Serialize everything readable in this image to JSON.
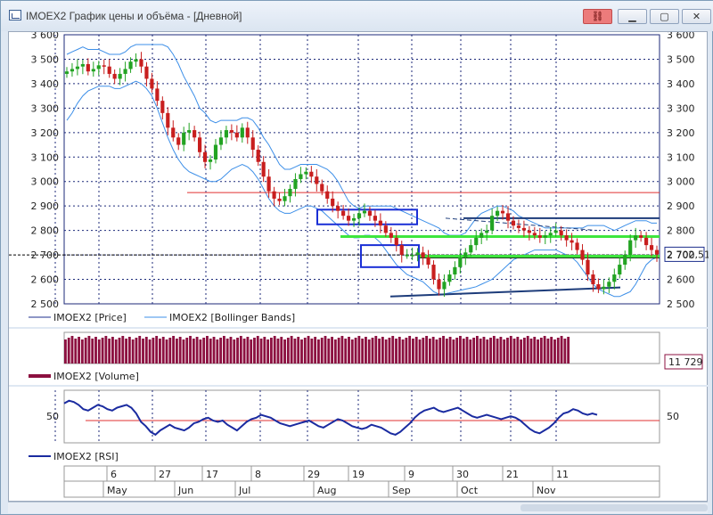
{
  "window": {
    "title": "IMOEX2 График цены и объёма - [Дневной]",
    "buttons": [
      "link",
      "minimize",
      "maximize",
      "close"
    ]
  },
  "colors": {
    "candle_up": "#22a322",
    "candle_down": "#c81e1e",
    "bollinger": "#3d8fe8",
    "price_line": "#1d2f8c",
    "volume": "#8c1040",
    "rsi": "#1a2ba0",
    "level_red": "#e03030",
    "level_green": "#3ee63e",
    "level_navy": "#1d3c7a",
    "box_blue": "#1a2fd6",
    "grid": "#1c2a7a"
  },
  "chart_data": [
    {
      "type": "candlestick",
      "panel": "price",
      "ylim": [
        2500,
        3600
      ],
      "yticks": [
        2500,
        2600,
        2700,
        2800,
        2900,
        3000,
        3100,
        3200,
        3300,
        3400,
        3500,
        3600
      ],
      "ytick_labels": [
        "2 500",
        "2 600",
        "2 700",
        "2 800",
        "2 900",
        "3 000",
        "3 100",
        "3 200",
        "3 300",
        "3 400",
        "3 500",
        "3 600"
      ],
      "last_value_label": "2 702,51",
      "series": [
        {
          "name": "IMOEX2 [Price]",
          "close": [
            3450,
            3460,
            3470,
            3480,
            3450,
            3460,
            3475,
            3470,
            3440,
            3420,
            3440,
            3460,
            3490,
            3500,
            3470,
            3420,
            3380,
            3330,
            3280,
            3220,
            3180,
            3150,
            3200,
            3210,
            3180,
            3120,
            3080,
            3090,
            3150,
            3180,
            3210,
            3200,
            3180,
            3220,
            3180,
            3130,
            3080,
            3020,
            2960,
            2930,
            2920,
            2940,
            2970,
            3010,
            3030,
            3040,
            3020,
            2990,
            2960,
            2930,
            2900,
            2880,
            2860,
            2840,
            2850,
            2870,
            2880,
            2860,
            2840,
            2820,
            2790,
            2770,
            2740,
            2700,
            2700,
            2700,
            2710,
            2690,
            2660,
            2600,
            2560,
            2590,
            2620,
            2650,
            2690,
            2710,
            2740,
            2770,
            2790,
            2800,
            2860,
            2880,
            2870,
            2840,
            2820,
            2810,
            2800,
            2790,
            2780,
            2770,
            2780,
            2790,
            2800,
            2780,
            2760,
            2750,
            2720,
            2680,
            2620,
            2580,
            2560,
            2570,
            2590,
            2620,
            2660,
            2700,
            2760,
            2780,
            2770,
            2740,
            2720,
            2702.51
          ]
        },
        {
          "name": "IMOEX2 [Bollinger Bands]",
          "upper": [
            3520,
            3530,
            3540,
            3550,
            3540,
            3540,
            3540,
            3530,
            3520,
            3520,
            3520,
            3530,
            3550,
            3560,
            3560,
            3560,
            3560,
            3560,
            3560,
            3550,
            3520,
            3480,
            3430,
            3390,
            3350,
            3300,
            3280,
            3250,
            3240,
            3250,
            3250,
            3250,
            3250,
            3260,
            3260,
            3250,
            3220,
            3180,
            3150,
            3110,
            3070,
            3050,
            3050,
            3060,
            3070,
            3070,
            3070,
            3070,
            3060,
            3050,
            3030,
            3000,
            2960,
            2920,
            2900,
            2890,
            2900,
            2900,
            2900,
            2900,
            2900,
            2900,
            2890,
            2880,
            2870,
            2860,
            2850,
            2840,
            2830,
            2820,
            2810,
            2790,
            2780,
            2780,
            2780,
            2790,
            2820,
            2850,
            2870,
            2880,
            2890,
            2900,
            2900,
            2890,
            2880,
            2860,
            2850,
            2840,
            2830,
            2820,
            2810,
            2810,
            2810,
            2810,
            2810,
            2810,
            2810,
            2810,
            2820,
            2820,
            2820,
            2820,
            2810,
            2800,
            2810,
            2820,
            2830,
            2840,
            2840,
            2840,
            2830,
            2830
          ],
          "lower": [
            3250,
            3280,
            3320,
            3350,
            3370,
            3380,
            3390,
            3390,
            3390,
            3380,
            3380,
            3390,
            3400,
            3410,
            3400,
            3380,
            3350,
            3300,
            3240,
            3180,
            3130,
            3090,
            3060,
            3040,
            3030,
            3020,
            3010,
            3000,
            3000,
            3010,
            3030,
            3050,
            3060,
            3070,
            3060,
            3040,
            3010,
            2970,
            2930,
            2900,
            2880,
            2870,
            2870,
            2880,
            2890,
            2900,
            2900,
            2890,
            2880,
            2860,
            2840,
            2820,
            2800,
            2780,
            2770,
            2770,
            2780,
            2780,
            2770,
            2750,
            2720,
            2690,
            2660,
            2640,
            2620,
            2610,
            2600,
            2590,
            2570,
            2550,
            2540,
            2540,
            2545,
            2550,
            2555,
            2560,
            2565,
            2570,
            2580,
            2590,
            2600,
            2620,
            2640,
            2660,
            2680,
            2690,
            2700,
            2710,
            2720,
            2720,
            2720,
            2720,
            2720,
            2710,
            2700,
            2690,
            2670,
            2640,
            2610,
            2580,
            2560,
            2550,
            2540,
            2530,
            2530,
            2540,
            2550,
            2580,
            2620,
            2660,
            2680,
            2690
          ]
        }
      ],
      "levels": [
        {
          "value": 2955,
          "color": "red"
        },
        {
          "value": 2775,
          "color": "green"
        },
        {
          "value": 2695,
          "color": "green"
        },
        {
          "value": 2850,
          "color": "navy"
        },
        {
          "value": 2700,
          "color": "black-dotted"
        }
      ]
    },
    {
      "type": "bar",
      "panel": "volume",
      "series": [
        {
          "name": "IMOEX2 [Volume]"
        }
      ],
      "last_value_label": "11 729"
    },
    {
      "type": "line",
      "panel": "rsi",
      "yticks": [
        50
      ],
      "ytick_labels": [
        "50"
      ],
      "reference_level": 44,
      "series": [
        {
          "name": "IMOEX2 [RSI]",
          "values": [
            68,
            72,
            70,
            66,
            60,
            58,
            62,
            66,
            64,
            60,
            58,
            62,
            64,
            66,
            62,
            54,
            42,
            36,
            28,
            24,
            30,
            34,
            38,
            34,
            32,
            30,
            34,
            40,
            42,
            46,
            48,
            44,
            42,
            44,
            38,
            34,
            30,
            36,
            42,
            46,
            48,
            52,
            50,
            48,
            44,
            40,
            38,
            36,
            38,
            40,
            42,
            44,
            40,
            36,
            34,
            38,
            42,
            46,
            44,
            40,
            36,
            34,
            32,
            34,
            38,
            36,
            34,
            30,
            26,
            24,
            28,
            34,
            40,
            48,
            54,
            58,
            60,
            62,
            58,
            56,
            58,
            60,
            62,
            58,
            54,
            50,
            48,
            50,
            52,
            50,
            48,
            46,
            48,
            50,
            48,
            44,
            38,
            32,
            28,
            26,
            30,
            34,
            40,
            48,
            54,
            56,
            60,
            58,
            54,
            52,
            54,
            52
          ]
        }
      ]
    }
  ],
  "axis": {
    "day_labels": [
      "6",
      "27",
      "17",
      "8",
      "29",
      "19",
      "9",
      "30",
      "21",
      "11"
    ],
    "month_labels": [
      "May",
      "Jun",
      "Jul",
      "Aug",
      "Sep",
      "Oct",
      "Nov"
    ]
  }
}
